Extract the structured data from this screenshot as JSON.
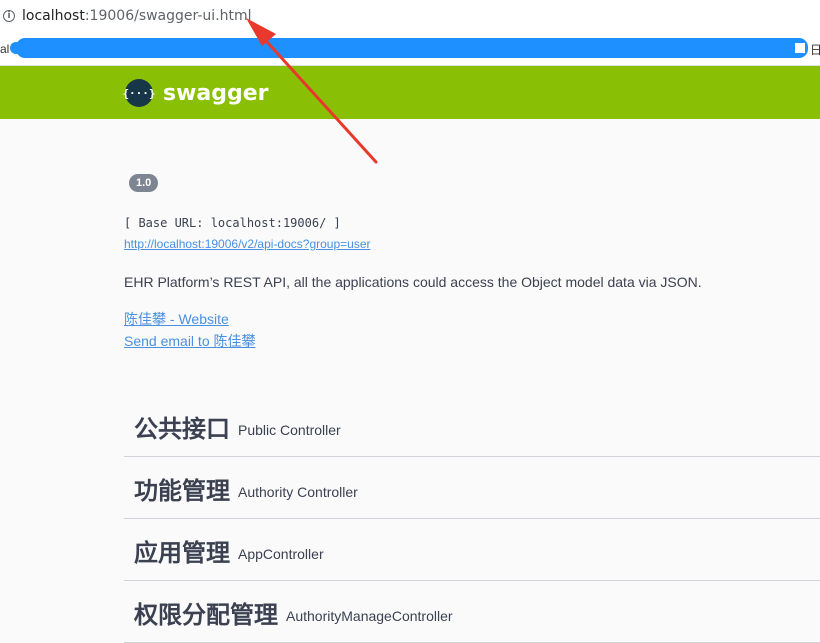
{
  "browser": {
    "info_icon": "info-icon",
    "url_host": "localhost",
    "url_path": ":19006/swagger-ui.html",
    "bookmarks_left": "al",
    "bookmarks_right": "日"
  },
  "header": {
    "logo_glyph": "{···}",
    "logo_text": "swagger",
    "color": "#89bf04"
  },
  "info": {
    "version": "1.0",
    "base_url": "[ Base URL: localhost:19006/ ]",
    "api_docs_link": "http://localhost:19006/v2/api-docs?group=user",
    "description": "EHR Platform’s REST API, all the applications could access the Object model data via JSON.",
    "contact_website": "陈佳攀 - Website",
    "contact_email": "Send email to 陈佳攀"
  },
  "tags": [
    {
      "name": "公共接口",
      "description": "Public Controller"
    },
    {
      "name": "功能管理",
      "description": "Authority Controller"
    },
    {
      "name": "应用管理",
      "description": "AppController"
    },
    {
      "name": "权限分配管理",
      "description": "AuthorityManageController"
    }
  ],
  "annotation": {
    "arrow_color": "#e8392c"
  }
}
